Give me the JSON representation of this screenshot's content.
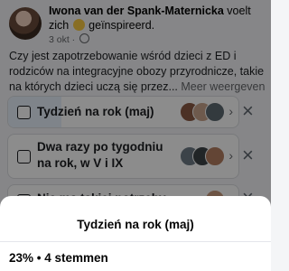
{
  "post": {
    "author_name": "Iwona van der Spank-Materniсka",
    "action_prefix": " voelt zich ",
    "feeling_icon": "smiling-face-emoji",
    "feeling": " geïnspireerd.",
    "date": "3 okt · ",
    "privacy_icon": "globe-icon",
    "text": "Czy jest zapotrzebowanie wśród dzieci z ED i rodziców na integracyjne obozy przyrodnicze, takie na których dzieci uczą się przez... ",
    "see_more": "Meer weergeven"
  },
  "poll": {
    "options": [
      {
        "label": "Tydzień na rok (maj)",
        "fill_percent": 23
      },
      {
        "label_line1": "Dwa razy po tygodniu",
        "label_line2": "na rok, w V i IX"
      },
      {
        "label": "Nie ma takiej potrzeby"
      }
    ]
  },
  "sheet": {
    "title": "Tydzień na rok (maj)",
    "stats": "23% • 4 stemmen"
  },
  "colors": {
    "accent_fill": "#e8f0fb",
    "overlay": "rgba(0,0,0,0.45)"
  }
}
